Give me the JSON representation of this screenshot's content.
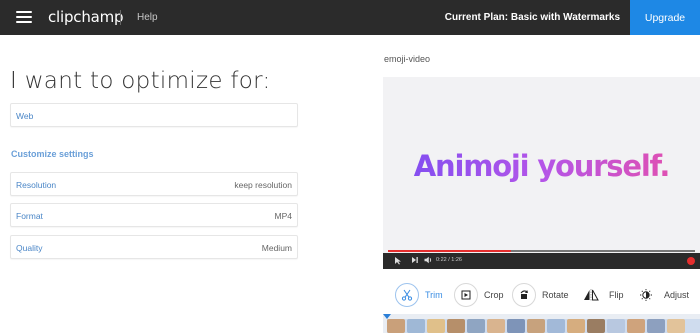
{
  "header": {
    "logo": "clipchamp",
    "help": "Help",
    "plan": "Current Plan: Basic with Watermarks",
    "upgrade": "Upgrade",
    "background": "#2b2b2b",
    "accent": "#1e88e5"
  },
  "left": {
    "heading": "I want to optimize for:",
    "target": "Web",
    "customize": "Customize settings",
    "settings": [
      {
        "label": "Resolution",
        "value": "keep resolution"
      },
      {
        "label": "Format",
        "value": "MP4"
      },
      {
        "label": "Quality",
        "value": "Medium"
      }
    ]
  },
  "preview": {
    "video_name": "emoji-video",
    "caption": "Animoji yourself.",
    "timecode": "0:22 / 1:26",
    "progress": 0.4
  },
  "tools": [
    {
      "label": "Trim",
      "icon": "scissors-icon",
      "active": true
    },
    {
      "label": "Crop",
      "icon": "crop-icon",
      "active": false
    },
    {
      "label": "Rotate",
      "icon": "rotate-icon",
      "active": false
    },
    {
      "label": "Flip",
      "icon": "flip-icon",
      "active": false
    },
    {
      "label": "Adjust",
      "icon": "adjust-icon",
      "active": false
    }
  ]
}
